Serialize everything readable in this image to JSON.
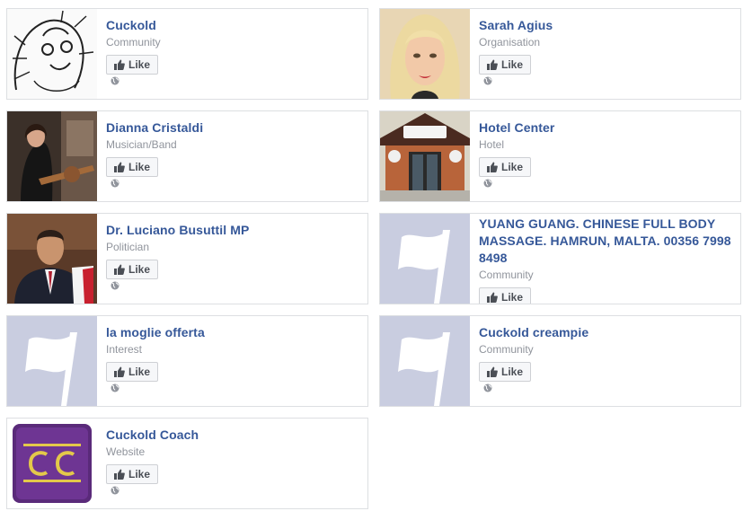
{
  "like_label": "Like",
  "colors": {
    "link": "#365899",
    "muted": "#90949c",
    "border": "#dddfe2",
    "placeholder": "#c9cde0"
  },
  "pages": [
    {
      "name": "Cuckold",
      "category": "Community",
      "thumb": "cartoon-sketch"
    },
    {
      "name": "Sarah Agius",
      "category": "Organisation",
      "thumb": "portrait-blonde"
    },
    {
      "name": "Dianna Cristaldi",
      "category": "Musician/Band",
      "thumb": "photo-guitarist"
    },
    {
      "name": "Hotel Center",
      "category": "Hotel",
      "thumb": "photo-hotel"
    },
    {
      "name": "Dr. Luciano Busuttil MP",
      "category": "Politician",
      "thumb": "photo-politician"
    },
    {
      "name": "YUANG GUANG. CHINESE FULL BODY MASSAGE. HAMRUN, MALTA. 00356 7998 8498",
      "category": "Community",
      "thumb": "flag-placeholder"
    },
    {
      "name": "la moglie offerta",
      "category": "Interest",
      "thumb": "flag-placeholder"
    },
    {
      "name": "Cuckold creampie",
      "category": "Community",
      "thumb": "flag-placeholder"
    },
    {
      "name": "Cuckold Coach",
      "category": "Website",
      "thumb": "cc-logo"
    }
  ]
}
